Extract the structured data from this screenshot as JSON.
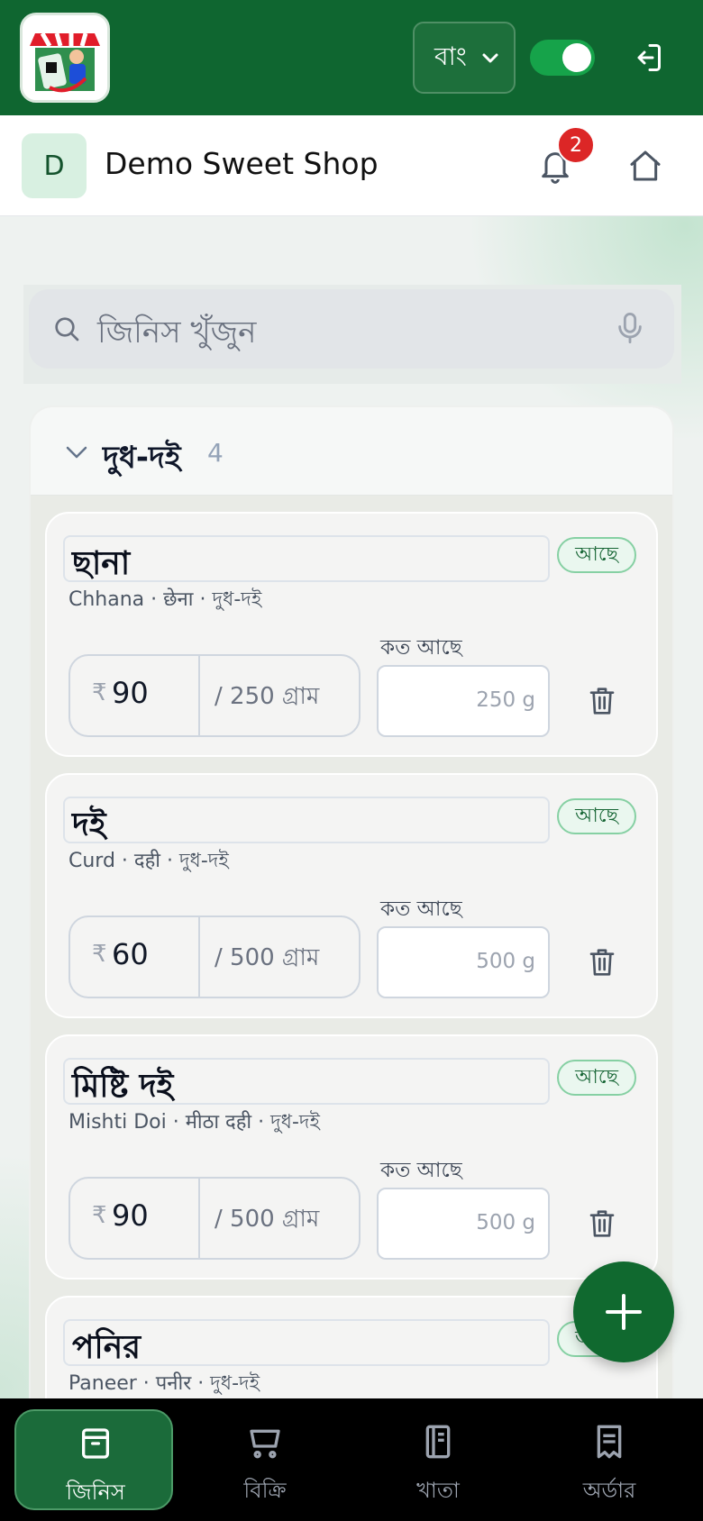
{
  "topbar": {
    "language": "বাং",
    "toggle_on": true
  },
  "shop": {
    "avatar_letter": "D",
    "name": "Demo Sweet Shop",
    "notification_count": "2"
  },
  "search": {
    "placeholder": "জিনিস খুঁজুন"
  },
  "category": {
    "title": "দুধ-দই",
    "count": "4",
    "items": [
      {
        "name": "ছানা",
        "subtitle": "Chhana · छेना · দুধ-দই",
        "status": "আছে",
        "price": "90",
        "unit": "/ 250 গ্রাম",
        "qty_label": "কত আছে",
        "qty": "250 g"
      },
      {
        "name": "দই",
        "subtitle": "Curd · दही · দুধ-দই",
        "status": "আছে",
        "price": "60",
        "unit": "/ 500 গ্রাম",
        "qty_label": "কত আছে",
        "qty": "500 g"
      },
      {
        "name": "মিষ্টি দই",
        "subtitle": "Mishti Doi · मीठा दही · দুধ-দই",
        "status": "আছে",
        "price": "90",
        "unit": "/ 500 গ্রাম",
        "qty_label": "কত আছে",
        "qty": "500 g"
      },
      {
        "name": "পনির",
        "subtitle": "Paneer · पनीर · দুধ-দই",
        "status": "আছে",
        "price": "",
        "unit": "",
        "qty_label": "",
        "qty": ""
      }
    ]
  },
  "currency_symbol": "₹",
  "nav": [
    {
      "label": "জিনিস",
      "icon": "box-icon",
      "active": true
    },
    {
      "label": "বিক্রি",
      "icon": "cart-icon",
      "active": false
    },
    {
      "label": "খাতা",
      "icon": "ledger-icon",
      "active": false
    },
    {
      "label": "অর্ডার",
      "icon": "receipt-icon",
      "active": false
    }
  ],
  "colors": {
    "brand_green": "#0f6630",
    "badge_red": "#dc2626",
    "stock_green": "#166534"
  }
}
